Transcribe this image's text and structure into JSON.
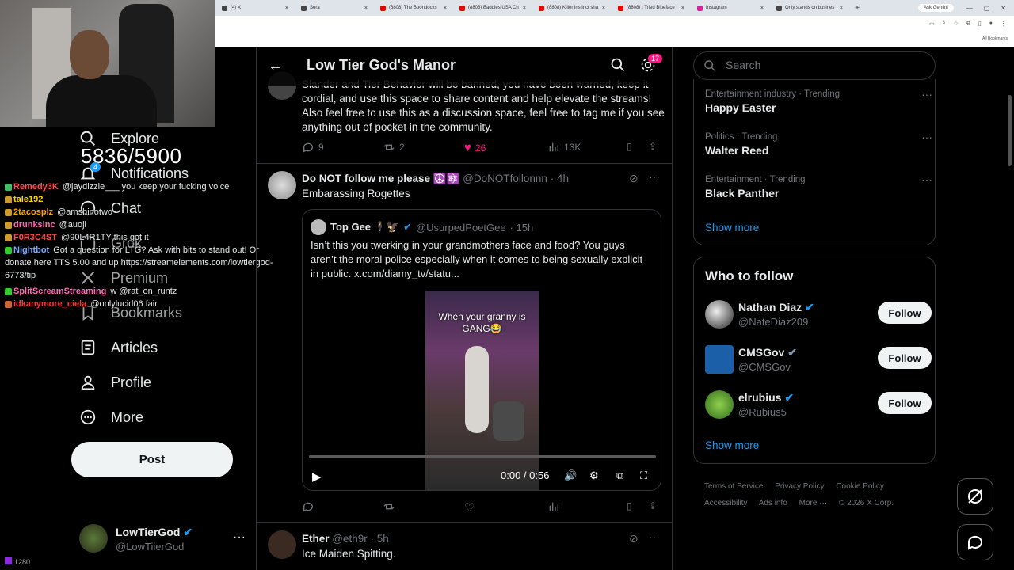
{
  "browser": {
    "tabs": [
      {
        "label": "(4) X"
      },
      {
        "label": "Sora"
      },
      {
        "label": "(8808) The Boondocks"
      },
      {
        "label": "(8808) Baddies USA Ch"
      },
      {
        "label": "(8808) Killer instinct sha"
      },
      {
        "label": "(8808) I Tried Blueface"
      },
      {
        "label": "Instagram"
      },
      {
        "label": "Only stands on busines"
      }
    ],
    "new_tab": "+",
    "gemini": "Ask Gemini",
    "all_bookmarks": "All Bookmarks"
  },
  "stream": {
    "goal_counter": "5836/5900",
    "viewers": "1280",
    "chat": [
      {
        "user": "Remedy3K",
        "message": "@jaydizzie___ you keep your fucking voice",
        "color": "#ff4d4d"
      },
      {
        "user": "tale192",
        "message": "",
        "color": "#ffd700"
      },
      {
        "user": "2tacosplz",
        "message": "@amshinotwo",
        "color": "#ffa500"
      },
      {
        "user": "drunksinc",
        "message": "@auoji",
        "color": "#ff69b4"
      },
      {
        "user": "F0R3C4ST",
        "message": "@90L4R1TY this got it",
        "color": "#ff4d4d"
      },
      {
        "user": "Nightbot",
        "message": "Got a question for LTG? Ask with bits to stand out! Or",
        "color": "#7aa8ff"
      },
      {
        "user": "",
        "message": "donate here TTS 5.00 and up https://streamelements.com/lowtiergod-",
        "color": "#fff"
      },
      {
        "user": "",
        "message": "6773/tip",
        "color": "#fff"
      },
      {
        "user": "SplitScreamStreaming",
        "message": "w @rat_on_runtz",
        "color": "#ff69b4"
      },
      {
        "user": "idkanymore_ciela",
        "message": "@onlylucid06 fair",
        "color": "#ff3030"
      }
    ]
  },
  "sidebar": {
    "items": [
      {
        "label": "Explore",
        "icon": "search-icon"
      },
      {
        "label": "Notifications",
        "icon": "bell-icon",
        "badge": "4"
      },
      {
        "label": "Chat",
        "icon": "chat-icon"
      },
      {
        "label": "Grok",
        "icon": "grok-icon"
      },
      {
        "label": "Premium",
        "icon": "x-icon"
      },
      {
        "label": "Bookmarks",
        "icon": "bookmark-icon"
      },
      {
        "label": "Articles",
        "icon": "article-icon"
      },
      {
        "label": "Profile",
        "icon": "person-icon"
      },
      {
        "label": "More",
        "icon": "more-circle-icon"
      }
    ],
    "post_label": "Post",
    "account": {
      "name": "LowTierGod",
      "handle": "@LowTiierGod"
    }
  },
  "main": {
    "title": "Low Tier God's Manor",
    "notification_count": "17",
    "pinned": {
      "text_lines": [
        "Slander and Tier Behavior will be banned, you have been warned, keep it",
        "cordial, and use this space to share content and help elevate the streams!",
        "Also feel free to use this as a discussion space, feel free to tag me if you see",
        "anything out of pocket in the community."
      ],
      "replies": "9",
      "reposts": "2",
      "likes": "26",
      "views": "13K"
    },
    "tweet1": {
      "name": "Do NOT follow me please ☮️⚛️",
      "handle": "@DoNOTfollonnn",
      "time": "· 4h",
      "text": "Embarassing Rogettes",
      "quote": {
        "name": "Top Gee 🕴️🦅",
        "handle": "@UsurpedPoetGee",
        "time": "· 15h",
        "text": "Isn’t this you twerking in your grandmothers face and food? You guys aren’t the moral police especially when it comes to being sexually explicit in public.",
        "link": "x.com/diamy_tv/statu...",
        "video_caption": "When your granny is GANG😂",
        "video_time": "0:00 / 0:56"
      }
    },
    "tweet2": {
      "name": "Ether",
      "handle": "@eth9r",
      "time": "· 5h",
      "text": "Ice Maiden Spitting."
    }
  },
  "right": {
    "search_placeholder": "Search",
    "trends": [
      {
        "category": "Entertainment industry · Trending",
        "topic": "Happy Easter"
      },
      {
        "category": "Politics · Trending",
        "topic": "Walter Reed"
      },
      {
        "category": "Entertainment · Trending",
        "topic": "Black Panther"
      }
    ],
    "show_more": "Show more",
    "who_to_follow_title": "Who to follow",
    "who_to_follow": [
      {
        "name": "Nathan Diaz",
        "handle": "@NateDiaz209",
        "button": "Follow"
      },
      {
        "name": "CMSGov",
        "handle": "@CMSGov",
        "button": "Follow"
      },
      {
        "name": "elrubius",
        "handle": "@Rubius5",
        "button": "Follow"
      }
    ],
    "show_more_2": "Show more",
    "footer": [
      "Terms of Service",
      "Privacy Policy",
      "Cookie Policy",
      "Accessibility",
      "Ads info",
      "More ···",
      "© 2026 X Corp."
    ]
  },
  "colors": {
    "accent": "#1d9bf0",
    "like": "#f91880",
    "background": "#000000",
    "border": "#2f3336"
  }
}
